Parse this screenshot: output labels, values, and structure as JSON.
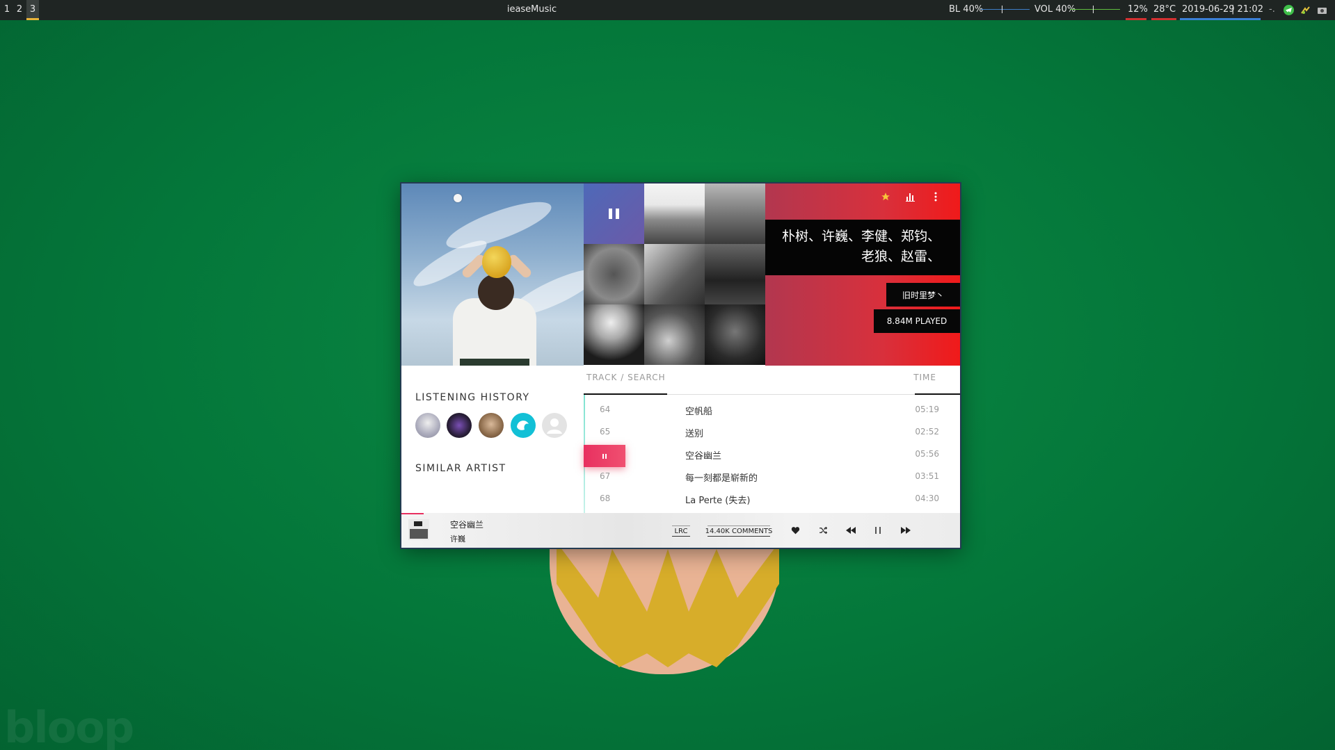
{
  "topbar": {
    "workspaces": [
      "1",
      "2",
      "3"
    ],
    "active_workspace": "3",
    "window_title": "ieaseMusic",
    "backlight_label": "BL 40%",
    "volume_label": "VOL 40%",
    "cpu": "12%",
    "temperature": "28°C",
    "date": "2019-06-29",
    "time": "| 21:02",
    "spinner": "-."
  },
  "cover": {
    "icon": "dot-indicator"
  },
  "info": {
    "artists_line1": "朴树、许巍、李健、郑钧、",
    "artists_line2": "老狼、赵雷、",
    "playlist_name": "旧时里梦丶",
    "played": "8.84M PLAYED",
    "icons": [
      "star-icon",
      "equalizer-icon",
      "more-vert-icon"
    ],
    "accent_gradient": [
      "#b2374f",
      "#f01a1a"
    ]
  },
  "sidebar": {
    "history_title": "LISTENING  HISTORY",
    "similar_title": "SIMILAR  ARTIST"
  },
  "tracks": {
    "header_left": "TRACK / SEARCH",
    "header_right": "TIME",
    "rows": [
      {
        "num": "64",
        "name": "空帆船",
        "time": "05:19"
      },
      {
        "num": "65",
        "name": "送别",
        "time": "02:52"
      },
      {
        "num": "",
        "name": "空谷幽兰",
        "time": "05:56",
        "playing": true
      },
      {
        "num": "67",
        "name": "每一刻都是崭新的",
        "time": "03:51"
      },
      {
        "num": "68",
        "name": "La Perte (失去)",
        "time": "04:30"
      }
    ]
  },
  "player": {
    "song": "空谷幽兰",
    "artist": "许巍",
    "lrc": "LRC",
    "comments": "14.40K COMMENTS",
    "progress_fraction": 0.04,
    "accent": "#e83060"
  }
}
